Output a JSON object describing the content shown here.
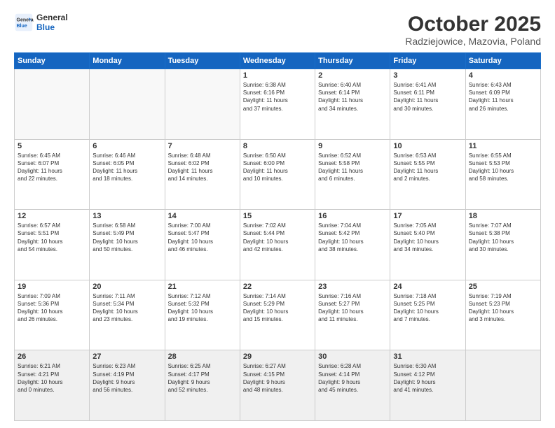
{
  "header": {
    "logo_line1": "General",
    "logo_line2": "Blue",
    "month": "October 2025",
    "location": "Radziejowice, Mazovia, Poland"
  },
  "days_of_week": [
    "Sunday",
    "Monday",
    "Tuesday",
    "Wednesday",
    "Thursday",
    "Friday",
    "Saturday"
  ],
  "weeks": [
    [
      {
        "day": "",
        "info": ""
      },
      {
        "day": "",
        "info": ""
      },
      {
        "day": "",
        "info": ""
      },
      {
        "day": "1",
        "info": "Sunrise: 6:38 AM\nSunset: 6:16 PM\nDaylight: 11 hours\nand 37 minutes."
      },
      {
        "day": "2",
        "info": "Sunrise: 6:40 AM\nSunset: 6:14 PM\nDaylight: 11 hours\nand 34 minutes."
      },
      {
        "day": "3",
        "info": "Sunrise: 6:41 AM\nSunset: 6:11 PM\nDaylight: 11 hours\nand 30 minutes."
      },
      {
        "day": "4",
        "info": "Sunrise: 6:43 AM\nSunset: 6:09 PM\nDaylight: 11 hours\nand 26 minutes."
      }
    ],
    [
      {
        "day": "5",
        "info": "Sunrise: 6:45 AM\nSunset: 6:07 PM\nDaylight: 11 hours\nand 22 minutes."
      },
      {
        "day": "6",
        "info": "Sunrise: 6:46 AM\nSunset: 6:05 PM\nDaylight: 11 hours\nand 18 minutes."
      },
      {
        "day": "7",
        "info": "Sunrise: 6:48 AM\nSunset: 6:02 PM\nDaylight: 11 hours\nand 14 minutes."
      },
      {
        "day": "8",
        "info": "Sunrise: 6:50 AM\nSunset: 6:00 PM\nDaylight: 11 hours\nand 10 minutes."
      },
      {
        "day": "9",
        "info": "Sunrise: 6:52 AM\nSunset: 5:58 PM\nDaylight: 11 hours\nand 6 minutes."
      },
      {
        "day": "10",
        "info": "Sunrise: 6:53 AM\nSunset: 5:55 PM\nDaylight: 11 hours\nand 2 minutes."
      },
      {
        "day": "11",
        "info": "Sunrise: 6:55 AM\nSunset: 5:53 PM\nDaylight: 10 hours\nand 58 minutes."
      }
    ],
    [
      {
        "day": "12",
        "info": "Sunrise: 6:57 AM\nSunset: 5:51 PM\nDaylight: 10 hours\nand 54 minutes."
      },
      {
        "day": "13",
        "info": "Sunrise: 6:58 AM\nSunset: 5:49 PM\nDaylight: 10 hours\nand 50 minutes."
      },
      {
        "day": "14",
        "info": "Sunrise: 7:00 AM\nSunset: 5:47 PM\nDaylight: 10 hours\nand 46 minutes."
      },
      {
        "day": "15",
        "info": "Sunrise: 7:02 AM\nSunset: 5:44 PM\nDaylight: 10 hours\nand 42 minutes."
      },
      {
        "day": "16",
        "info": "Sunrise: 7:04 AM\nSunset: 5:42 PM\nDaylight: 10 hours\nand 38 minutes."
      },
      {
        "day": "17",
        "info": "Sunrise: 7:05 AM\nSunset: 5:40 PM\nDaylight: 10 hours\nand 34 minutes."
      },
      {
        "day": "18",
        "info": "Sunrise: 7:07 AM\nSunset: 5:38 PM\nDaylight: 10 hours\nand 30 minutes."
      }
    ],
    [
      {
        "day": "19",
        "info": "Sunrise: 7:09 AM\nSunset: 5:36 PM\nDaylight: 10 hours\nand 26 minutes."
      },
      {
        "day": "20",
        "info": "Sunrise: 7:11 AM\nSunset: 5:34 PM\nDaylight: 10 hours\nand 23 minutes."
      },
      {
        "day": "21",
        "info": "Sunrise: 7:12 AM\nSunset: 5:32 PM\nDaylight: 10 hours\nand 19 minutes."
      },
      {
        "day": "22",
        "info": "Sunrise: 7:14 AM\nSunset: 5:29 PM\nDaylight: 10 hours\nand 15 minutes."
      },
      {
        "day": "23",
        "info": "Sunrise: 7:16 AM\nSunset: 5:27 PM\nDaylight: 10 hours\nand 11 minutes."
      },
      {
        "day": "24",
        "info": "Sunrise: 7:18 AM\nSunset: 5:25 PM\nDaylight: 10 hours\nand 7 minutes."
      },
      {
        "day": "25",
        "info": "Sunrise: 7:19 AM\nSunset: 5:23 PM\nDaylight: 10 hours\nand 3 minutes."
      }
    ],
    [
      {
        "day": "26",
        "info": "Sunrise: 6:21 AM\nSunset: 4:21 PM\nDaylight: 10 hours\nand 0 minutes."
      },
      {
        "day": "27",
        "info": "Sunrise: 6:23 AM\nSunset: 4:19 PM\nDaylight: 9 hours\nand 56 minutes."
      },
      {
        "day": "28",
        "info": "Sunrise: 6:25 AM\nSunset: 4:17 PM\nDaylight: 9 hours\nand 52 minutes."
      },
      {
        "day": "29",
        "info": "Sunrise: 6:27 AM\nSunset: 4:15 PM\nDaylight: 9 hours\nand 48 minutes."
      },
      {
        "day": "30",
        "info": "Sunrise: 6:28 AM\nSunset: 4:14 PM\nDaylight: 9 hours\nand 45 minutes."
      },
      {
        "day": "31",
        "info": "Sunrise: 6:30 AM\nSunset: 4:12 PM\nDaylight: 9 hours\nand 41 minutes."
      },
      {
        "day": "",
        "info": ""
      }
    ]
  ]
}
